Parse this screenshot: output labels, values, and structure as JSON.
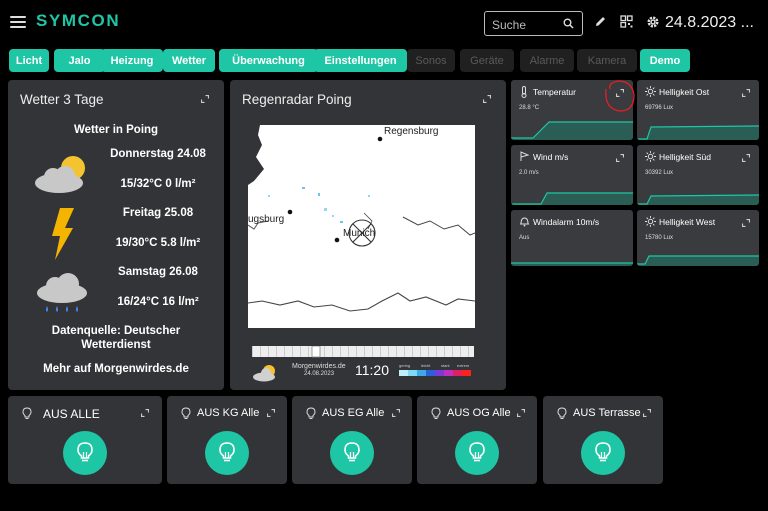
{
  "app": {
    "logo": "SYMCON"
  },
  "search": {
    "placeholder": "Suche"
  },
  "header": {
    "date": "24.8.2023 ..."
  },
  "tabs": [
    {
      "label": "Licht",
      "active": true
    },
    {
      "label": "Jalo",
      "active": true
    },
    {
      "label": "Heizung",
      "active": true
    },
    {
      "label": "Wetter",
      "active": true
    },
    {
      "label": "Überwachung",
      "active": true
    },
    {
      "label": "Einstellungen",
      "active": true
    },
    {
      "label": "Sonos",
      "active": false
    },
    {
      "label": "Geräte",
      "active": false
    },
    {
      "label": "Alarme",
      "active": false
    },
    {
      "label": "Kamera",
      "active": false
    },
    {
      "label": "Demo",
      "active": true
    }
  ],
  "weather": {
    "title": "Wetter 3 Tage",
    "heading": "Wetter in Poing",
    "days": [
      {
        "day": "Donnerstag 24.08",
        "detail": "15/32°C 0 l/m²",
        "icon": "partly-cloudy-icon"
      },
      {
        "day": "Freitag 25.08",
        "detail": "19/30°C 5.8 l/m²",
        "icon": "lightning-icon"
      },
      {
        "day": "Samstag 26.08",
        "detail": "16/24°C 16 l/m²",
        "icon": "rain-cloud-icon"
      }
    ],
    "source_line1": "Datenquelle: Deutscher",
    "source_line2": "Wetterdienst",
    "more": "Mehr auf Morgenwirdes.de"
  },
  "radar": {
    "title": "Regenradar Poing",
    "cities": [
      "Regensburg",
      "ugsburg",
      "Munich"
    ],
    "brand": "Morgenwirdes.de",
    "date": "24.08.2023",
    "time": "11:20",
    "legend_labels": [
      "gering",
      "leicht",
      "stark",
      "extrem"
    ]
  },
  "sensors": [
    {
      "title": "Temperatur",
      "value": "28.8 °C",
      "icon": "thermometer-icon"
    },
    {
      "title": "Helligkeit Ost",
      "value": "69796 Lux",
      "icon": "sun-icon"
    },
    {
      "title": "Wind m/s",
      "value": "2.0 m/s",
      "icon": "wind-icon"
    },
    {
      "title": "Helligkeit Süd",
      "value": "30392 Lux",
      "icon": "sun-icon"
    },
    {
      "title": "Windalarm 10m/s",
      "value": "Aus",
      "icon": "bell-icon"
    },
    {
      "title": "Helligkeit West",
      "value": "15780 Lux",
      "icon": "sun-icon"
    }
  ],
  "buttons": [
    {
      "title": "AUS ALLE",
      "icon": "lightbulb-icon"
    },
    {
      "title": "AUS KG Alle",
      "icon": "lightbulb-icon"
    },
    {
      "title": "AUS EG Alle",
      "icon": "lightbulb-icon"
    },
    {
      "title": "AUS OG Alle",
      "icon": "lightbulb-icon"
    },
    {
      "title": "AUS Terrasse",
      "icon": "lightbulb-icon"
    }
  ],
  "colors": {
    "accent": "#1fc6a6",
    "card": "#333437",
    "annotation": "#e0202a"
  }
}
